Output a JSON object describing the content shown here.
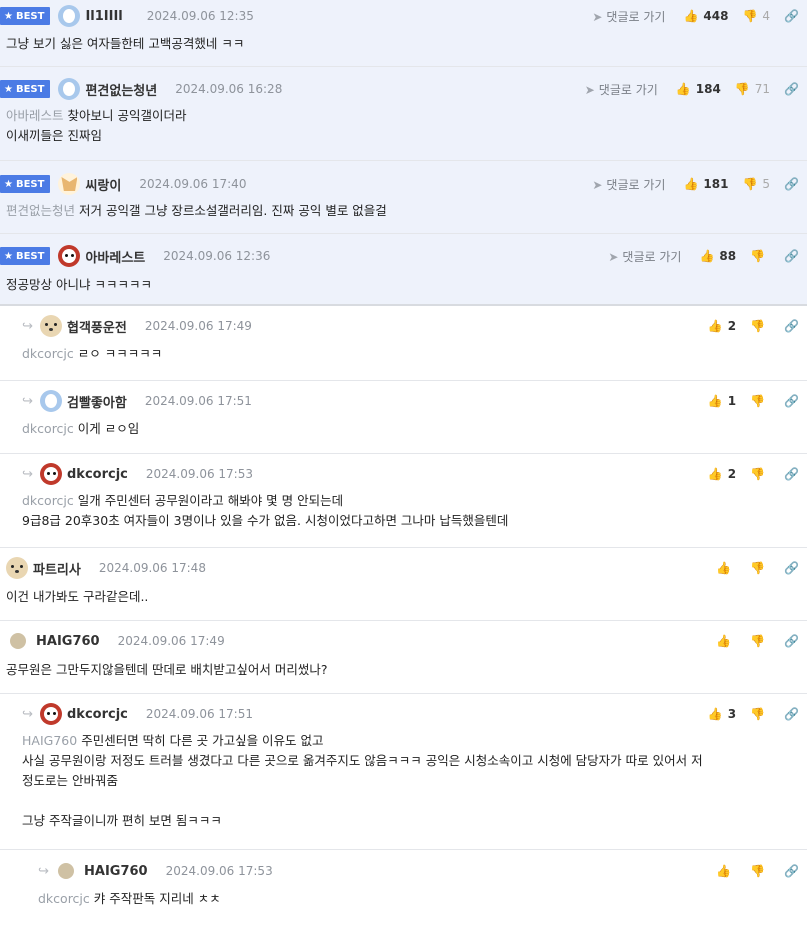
{
  "labels": {
    "best": "BEST",
    "goto": "댓글로 가기"
  },
  "icons": {
    "best_star": "star-icon",
    "goto": "send-arrow-icon",
    "upvote": "thumbs-up-icon",
    "downvote": "thumbs-down-icon",
    "link": "link-icon",
    "reply": "reply-arrow-icon"
  },
  "colors": {
    "best_badge": "#4b7be5",
    "best_bg": "#eef2fb",
    "mention": "#9aa0a8"
  },
  "comments": [
    {
      "best": true,
      "nick": "Il1IIIl",
      "date": "2024.09.06 12:35",
      "up": "448",
      "down": "4",
      "lines": [
        "그냥 보기 싫은 여자들한테 고백공격했네 ㅋㅋ"
      ]
    },
    {
      "best": true,
      "nick": "편견없는청년",
      "date": "2024.09.06 16:28",
      "up": "184",
      "down": "71",
      "mention_line": "아바레스트",
      "lines": [
        "찾아보니 공익갤이더라",
        "이새끼들은 진짜임"
      ]
    },
    {
      "best": true,
      "nick": "씨랑이",
      "date": "2024.09.06 17:40",
      "up": "181",
      "down": "5",
      "mention": "편견없는청년",
      "lines": [
        "저거 공익갤 그냥 장르소설갤러리임. 진짜 공익 별로 없을걸"
      ]
    },
    {
      "best": true,
      "nick": "아바레스트",
      "date": "2024.09.06 12:36",
      "up": "88",
      "lines": [
        "정공망상 아니냐 ㅋㅋㅋㅋㅋ"
      ]
    },
    {
      "nick": "협객풍운전",
      "date": "2024.09.06 17:49",
      "up": "2",
      "mention": "dkcorcjc",
      "lines": [
        "ㄹㅇ ㅋㅋㅋㅋㅋ"
      ]
    },
    {
      "nick": "검빨좋아함",
      "date": "2024.09.06 17:51",
      "up": "1",
      "mention": "dkcorcjc",
      "lines": [
        "이게 ㄹㅇ임"
      ]
    },
    {
      "nick": "dkcorcjc",
      "date": "2024.09.06 17:53",
      "up": "2",
      "mention": "dkcorcjc",
      "lines": [
        "일개 주민센터 공무원이라고 해봐야 몇 명 안되는데",
        "9급8급 20후30초 여자들이 3명이나 있을 수가 없음. 시청이었다고하면 그나마 납득했을텐데"
      ]
    },
    {
      "nick": "파트리사",
      "date": "2024.09.06 17:48",
      "lines": [
        "이건 내가봐도 구라같은데.."
      ]
    },
    {
      "nick": "HAIG760",
      "date": "2024.09.06 17:49",
      "lines": [
        "공무원은 그만두지않을텐데 딴데로 배치받고싶어서 머리썼나?"
      ]
    },
    {
      "nick": "dkcorcjc",
      "date": "2024.09.06 17:51",
      "up": "3",
      "mention": "HAIG760",
      "lines": [
        "주민센터면 딱히 다른 곳 가고싶을 이유도 없고",
        "사실 공무원이랑 저정도 트러블 생겼다고 다른 곳으로 옮겨주지도 않음ㅋㅋㅋ 공익은 시청소속이고 시청에 담당자가 따로 있어서 저",
        "정도로는 안바꿔줌",
        "",
        "그냥 주작글이니까 편히 보면 됨ㅋㅋㅋ"
      ]
    },
    {
      "nick": "HAIG760",
      "date": "2024.09.06 17:53",
      "mention": "dkcorcjc",
      "lines": [
        "캬 주작판독 지리네 ㅊㅊ"
      ]
    }
  ]
}
